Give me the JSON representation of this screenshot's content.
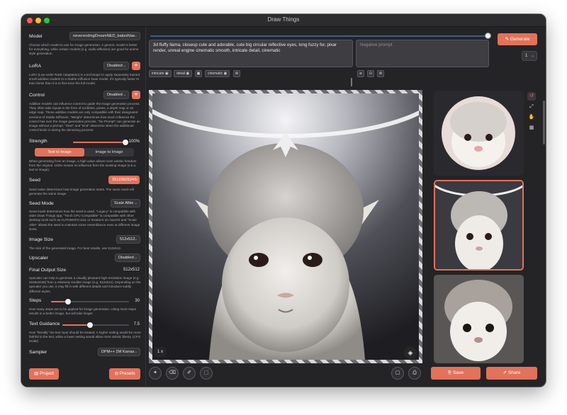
{
  "window": {
    "title": "Draw Things"
  },
  "sidebar": {
    "model": {
      "label": "Model",
      "value": "neverendingDreamNED_bakedVae",
      "desc": "Choose which model to use for image generation. A generic model is better for everything, while certain models (e.g. waifu-diffusion) are good for anime style generation."
    },
    "lora": {
      "label": "LoRA",
      "value": "Disabled",
      "desc": "LoRA (Low-order Rank Adaptation) is a technique to apply separately trained small additive models to a Stable Diffusion base model. It's typically faster to train these than it is to fine-tune the full model."
    },
    "control": {
      "label": "Control",
      "value": "Disabled",
      "desc": "Additive models can influence control to guide the image generation process. They often take inputs in the form of scribbles, poses, a depth map or an edge map. These additive models are only compatible with their designated versions of Stable Diffusion. \"Weight\" determines how much influence the control has over the image generation process. \"No Prompt\" can generate an image without a prompt. \"Start\" and \"End\" determine when the additional control kicks in during the denoising process."
    },
    "strength": {
      "label": "Strength",
      "value": "100%",
      "level": 1.0,
      "mode_a": "Text to Image",
      "mode_b": "Image to Image",
      "desc": "When generating from an image, a high value allows more artistic freedom from the original. 100% means no influence from the existing image (a.k.a. text to image)."
    },
    "seed": {
      "label": "Seed",
      "value": "2512262524",
      "desc": "Seed value determines how image generation starts. The same seed will generate the same image."
    },
    "seed_mode": {
      "label": "Seed Mode",
      "value": "Scale Alike",
      "desc": "Seed mode determines how the seed is used. \"Legacy\" is compatible with older Draw Things app, \"Torch CPU Compatible\" is compatible with other desktop tools such as AUTOMATIC1111 or InvokeAI on macOS and \"Scale Alike\" allows the seed to maintain some resemblance even at different image sizes."
    },
    "image_size": {
      "label": "Image Size",
      "value": "512x512",
      "desc": "The size of the generated image. For best results, use 512x512."
    },
    "upscaler": {
      "label": "Upscaler",
      "value": "Disabled"
    },
    "final_size": {
      "label": "Final Output Size",
      "value": "512x512",
      "desc": "Upscaler can help to generate a visually pleasant high-resolution image (e.g. 2048x2048) from a relatively smaller image (e.g. 512x512). Depending on the upscaler you use, it may fill in with different details and introduce subtly different styles."
    },
    "steps": {
      "label": "Steps",
      "value": "30",
      "level": 0.22,
      "desc": "How many steps are to be applied for image generation. Using more steps results in a better image, but will take longer."
    },
    "guidance": {
      "label": "Text Guidance",
      "value": "7.5",
      "level": 0.41,
      "desc": "How \"literally\" the text input should be treated. A higher setting would be more faithful to the text, while a lower setting would allow more artistic liberty. (CFG Scale)"
    },
    "sampler": {
      "label": "Sampler",
      "value": "DPM++ 2M Karras"
    },
    "project_label": "Project",
    "presets_label": "Presets"
  },
  "prompt": {
    "text": "3d fluffy llama, closeup cute and adorable, cute big circular reflective eyes, long fuzzy fur, pixar render, unreal engine cinematic smooth, intricate detail, cinematic",
    "negative_placeholder": "Negative prompt",
    "chips": [
      "intricate",
      "detail",
      "cinematic"
    ]
  },
  "toolbar": {
    "generate_label": "Generate",
    "count": "1"
  },
  "canvas": {
    "zoom": "1 x"
  },
  "actions": {
    "save_label": "Save",
    "share_label": "Share"
  },
  "colors": {
    "accent": "#e2725b",
    "background": "#242426"
  }
}
